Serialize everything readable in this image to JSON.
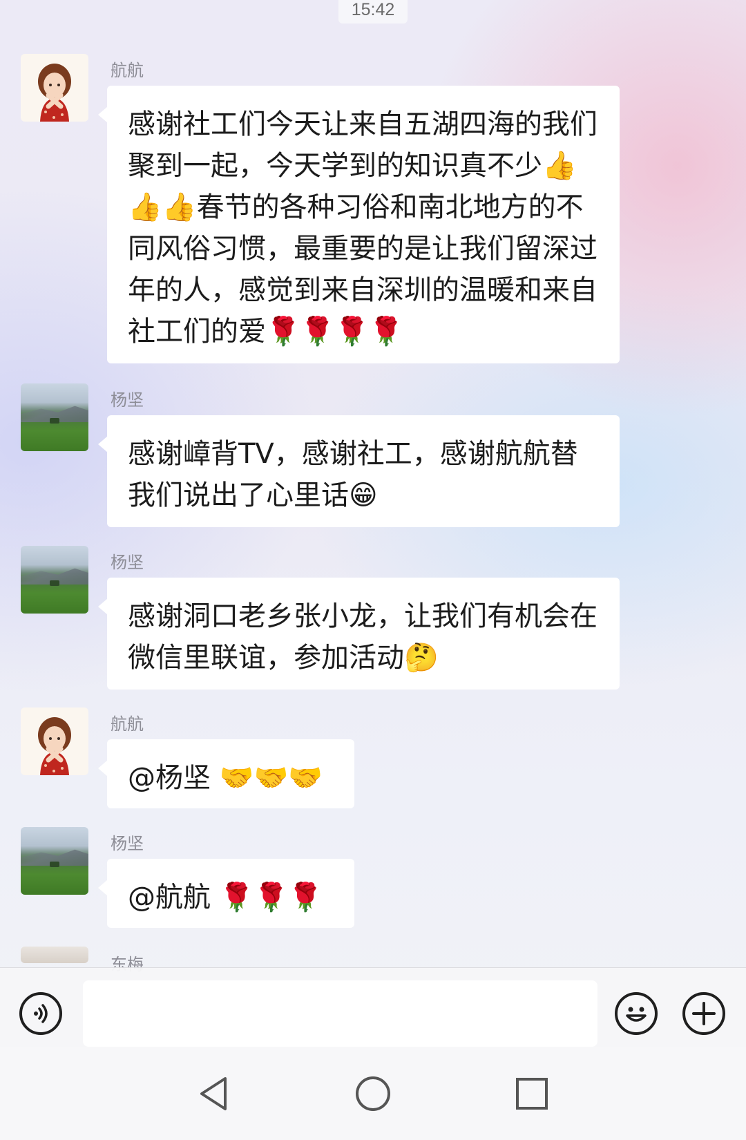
{
  "status": {
    "time": "15:42"
  },
  "messages": [
    {
      "sender": "航航",
      "avatar": "girl-avatar",
      "text": "感谢社工们今天让来自五湖四海的我们聚到一起，今天学到的知识真不少👍👍👍春节的各种习俗和南北地方的不同风俗习惯，最重要的是让我们留深过年的人，感觉到来自深圳的温暖和来自社工们的爱🌹🌹🌹🌹"
    },
    {
      "sender": "杨坚",
      "avatar": "landscape-avatar",
      "text": "感谢嶂背TV，感谢社工，感谢航航替我们说出了心里话😁"
    },
    {
      "sender": "杨坚",
      "avatar": "landscape-avatar",
      "text": "感谢洞口老乡张小龙，让我们有机会在微信里联谊，参加活动🤔"
    },
    {
      "sender": "航航",
      "avatar": "girl-avatar",
      "text": "@杨坚 🤝🤝🤝"
    },
    {
      "sender": "杨坚",
      "avatar": "landscape-avatar",
      "text": "@航航 🌹🌹🌹"
    },
    {
      "sender": "东梅",
      "avatar": "partial-avatar",
      "text": ""
    }
  ],
  "input_bar": {
    "voice_icon": "voice-icon",
    "input_value": "",
    "emoji_icon": "emoji-icon",
    "add_icon": "plus-icon"
  },
  "nav_bar": {
    "back_icon": "back-triangle-icon",
    "home_icon": "home-circle-icon",
    "recent_icon": "recent-square-icon"
  },
  "colors": {
    "bubble": "#ffffff",
    "name": "#8d8d96",
    "text": "#1c1c1c"
  }
}
